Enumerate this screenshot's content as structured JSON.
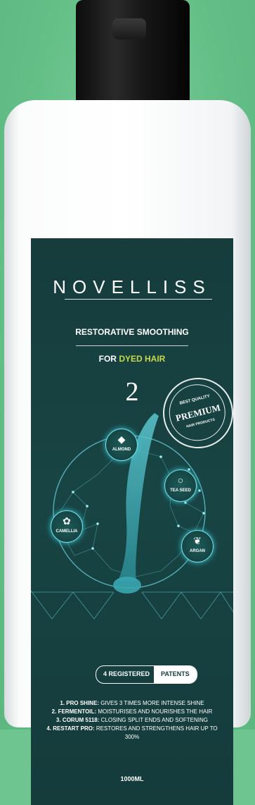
{
  "product": {
    "brand": "NOVELLISS",
    "title": "RESTORATIVE SMOOTHING",
    "subtitle_prefix": "FOR",
    "subtitle_accent": "DYED HAIR",
    "number": "2",
    "stamp": {
      "top": "BEST QUALITY",
      "main": "PREMIUM",
      "bottom": "HAIR PRODUCTS"
    },
    "ingredients": [
      {
        "name": "ALMOND",
        "icon": "almond-icon"
      },
      {
        "name": "TEA SEED",
        "icon": "tea-seed-icon"
      },
      {
        "name": "CAMELLIA",
        "icon": "camellia-icon"
      },
      {
        "name": "ARGAN",
        "icon": "argan-icon"
      }
    ],
    "patents": {
      "count_label": "4 REGISTERED",
      "word": "PATENTS"
    },
    "features": [
      {
        "key": "1. PRO SHINE:",
        "text": "GIVES 3 TIMES MORE INTENSE SHINE"
      },
      {
        "key": "2. FERMENTOIL:",
        "text": "MOISTURISES AND NOURISHES THE HAIR"
      },
      {
        "key": "3. CORUM 5118:",
        "text": "CLOSING SPLIT ENDS AND SOFTENING"
      },
      {
        "key": "4. RESTART PRO:",
        "text": "RESTORES AND STRENGTHENS HAIR UP TO 300%"
      }
    ],
    "volume": "1000ML",
    "colors": {
      "label": "#163c3c",
      "accent": "#c6d94a",
      "glow": "#38c8d8",
      "background": "#6ec58f"
    }
  }
}
